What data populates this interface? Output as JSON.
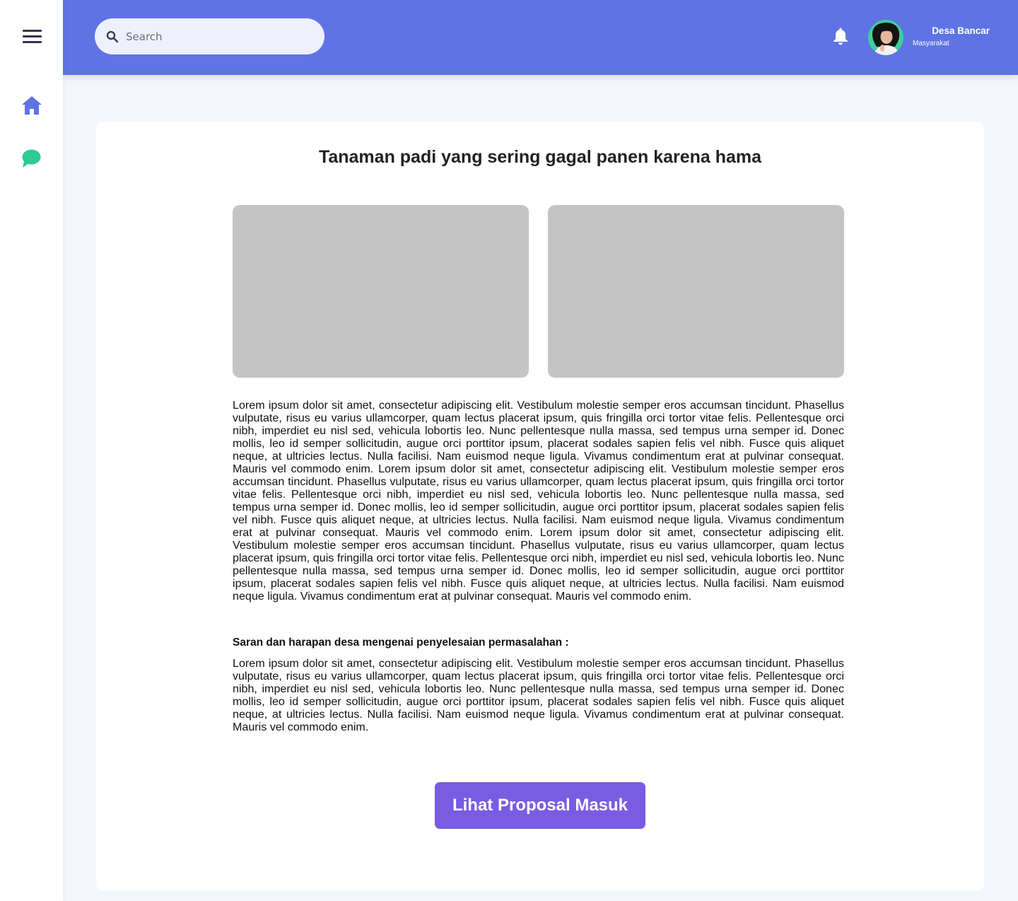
{
  "nav": {
    "menu_icon": "hamburger-menu-icon",
    "items": [
      {
        "name": "home",
        "icon": "home-icon",
        "color": "#5f73e4"
      },
      {
        "name": "chat",
        "icon": "chat-bubble-icon",
        "color": "#2ecc8f"
      }
    ]
  },
  "header": {
    "search_placeholder": "Search",
    "search_value": "",
    "notification_icon": "bell-icon",
    "user": {
      "name": "Desa Bancar",
      "role": "Masyarakat"
    },
    "background_color": "#5f73e4"
  },
  "main": {
    "title": "Tanaman padi yang sering gagal panen karena hama",
    "description": "Lorem ipsum dolor sit amet, consectetur adipiscing elit. Vestibulum molestie semper eros accumsan tincidunt. Phasellus vulputate, risus eu varius ullamcorper, quam lectus placerat ipsum, quis fringilla orci tortor vitae felis. Pellentesque orci nibh, imperdiet eu nisl sed, vehicula lobortis leo. Nunc pellentesque nulla massa, sed tempus urna semper id. Donec mollis, leo id semper sollicitudin, augue orci porttitor ipsum, placerat sodales sapien felis vel nibh. Fusce quis aliquet neque, at ultricies lectus. Nulla facilisi. Nam euismod neque ligula. Vivamus condimentum erat at pulvinar consequat. Mauris vel commodo enim. Lorem ipsum dolor sit amet, consectetur adipiscing elit. Vestibulum molestie semper eros accumsan tincidunt. Phasellus vulputate, risus eu varius ullamcorper, quam lectus placerat ipsum, quis fringilla orci tortor vitae felis. Pellentesque orci nibh, imperdiet eu nisl sed, vehicula lobortis leo. Nunc pellentesque nulla massa, sed tempus urna semper id. Donec mollis, leo id semper sollicitudin, augue orci porttitor ipsum, placerat sodales sapien felis vel nibh. Fusce quis aliquet neque, at ultricies lectus. Nulla facilisi. Nam euismod neque ligula. Vivamus condimentum erat at pulvinar consequat. Mauris vel commodo enim. Lorem ipsum dolor sit amet, consectetur adipiscing elit. Vestibulum molestie semper eros accumsan tincidunt. Phasellus vulputate, risus eu varius ullamcorper, quam lectus placerat ipsum, quis fringilla orci tortor vitae felis. Pellentesque orci nibh, imperdiet eu nisl sed, vehicula lobortis leo. Nunc pellentesque nulla massa, sed tempus urna semper id. Donec mollis, leo id semper sollicitudin, augue orci porttitor ipsum, placerat sodales sapien felis vel nibh. Fusce quis aliquet neque, at ultricies lectus. Nulla facilisi. Nam euismod neque ligula. Vivamus condimentum erat at pulvinar consequat. Mauris vel commodo enim.",
    "suggestion_heading": "Saran dan harapan desa mengenai penyelesaian permasalahan :",
    "suggestion_text": "Lorem ipsum dolor sit amet, consectetur adipiscing elit. Vestibulum molestie semper eros accumsan tincidunt. Phasellus vulputate, risus eu varius ullamcorper, quam lectus placerat ipsum, quis fringilla orci tortor vitae felis. Pellentesque orci nibh, imperdiet eu nisl sed, vehicula lobortis leo. Nunc pellentesque nulla massa, sed tempus urna semper id. Donec mollis, leo id semper sollicitudin, augue orci porttitor ipsum, placerat sodales sapien felis vel nibh. Fusce quis aliquet neque, at ultricies lectus. Nulla facilisi. Nam euismod neque ligula. Vivamus condimentum erat at pulvinar consequat. Mauris vel commodo enim.",
    "cta_label": "Lihat Proposal Masuk",
    "cta_color": "#7a5ce3"
  }
}
